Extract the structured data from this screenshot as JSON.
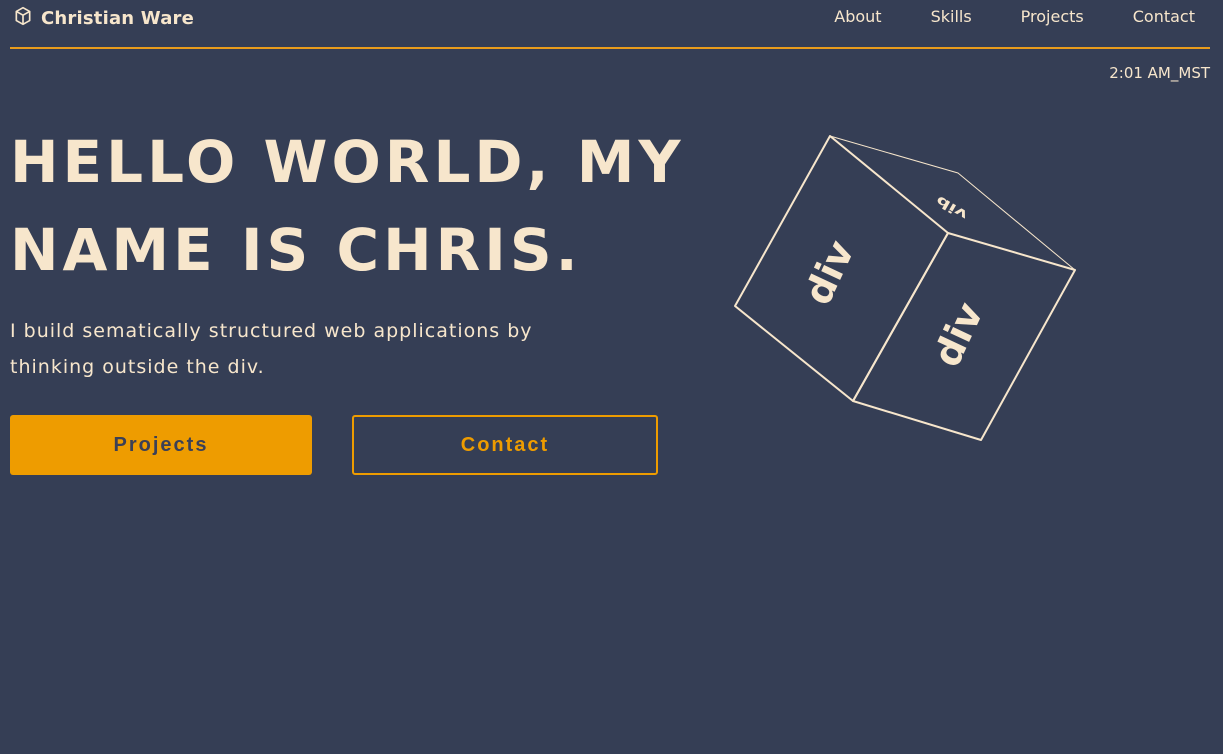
{
  "header": {
    "brand": "Christian Ware",
    "nav": [
      "About",
      "Skills",
      "Projects",
      "Contact"
    ]
  },
  "time": "2:01 AM_MST",
  "hero": {
    "title_line_1": "HELLO WORLD, MY",
    "title_line_2": "NAME IS CHRIS.",
    "subtitle_line_1": "I build sematically structured web applications by",
    "subtitle_line_2": "thinking outside the div.",
    "projects_label": "Projects",
    "contact_label": "Contact"
  },
  "cube": {
    "face_label": "div"
  },
  "colors": {
    "background": "#353e55",
    "text": "#f7e6cc",
    "accent": "#ee9c00"
  }
}
